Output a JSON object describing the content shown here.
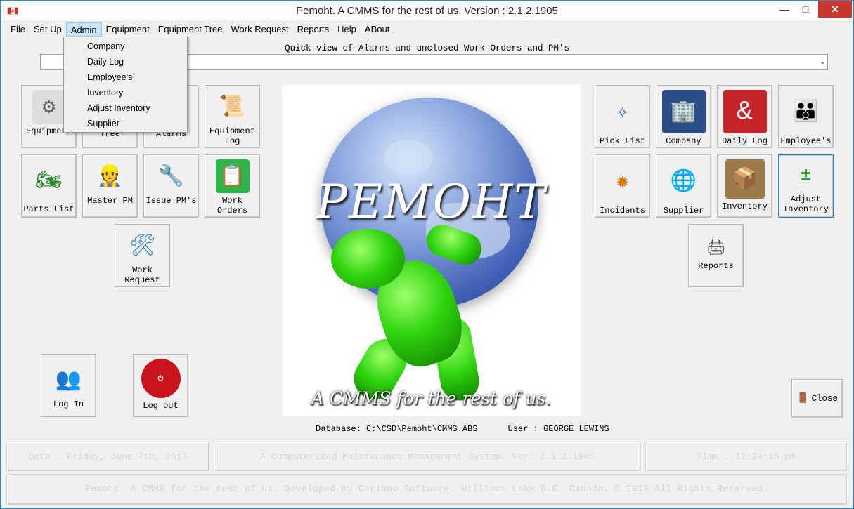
{
  "window": {
    "title": "Pemoht.  A CMMS for the rest of us.  Version : 2.1.2.1905"
  },
  "menu": [
    "File",
    "Set Up",
    "Admin",
    "Equipment",
    "Equipment Tree",
    "Work Request",
    "Reports",
    "Help",
    "ABout"
  ],
  "admin_menu": [
    "Company",
    "Daily Log",
    "Employee's",
    "Inventory",
    "Adjust Inventory",
    "Supplier"
  ],
  "quick_view_label": "Quick view of Alarms and unclosed Work Orders and PM's",
  "left_tiles": {
    "equipment": "Equipment",
    "tree": "Tree",
    "alarms": "Alarms",
    "equipment_log_1": "Equipment",
    "equipment_log_2": "Log",
    "parts_list": "Parts List",
    "master_pm": "Master PM",
    "issue_pms": "Issue PM's",
    "work_orders": "Work Orders",
    "work_request_1": "Work",
    "work_request_2": "Request"
  },
  "right_tiles": {
    "pick_list": "Pick List",
    "company": "Company",
    "daily_log": "Daily Log",
    "employees": "Employee's",
    "incidents": "Incidents",
    "supplier": "Supplier",
    "inventory": "Inventory",
    "adjust_inventory_1": "Adjust",
    "adjust_inventory_2": "Inventory",
    "reports": "Reports"
  },
  "login": "Log In",
  "logout": "Log out",
  "close": "Close",
  "splash": {
    "brand": "PEMOHT",
    "tagline": "A CMMS for the rest of us."
  },
  "database_line": "Database: C:\\CSD\\Pemoht\\CMMS.ABS      User : GEORGE LEWINS",
  "status": {
    "date": "Date : Friday, June 7th, 2013",
    "system": "A Computerized Maintenance Management System. Ver: 2.1.2.1905",
    "time": "Time : 12:24:15 pm"
  },
  "footer": "Pemoht.  A CMMS for the rest of us.  Developed by Cariboo Software.  Williams Lake B.C. Canada. © 2013 All Rights Reserved.",
  "colors": {
    "accent_border": "#1e8dcf",
    "close_red": "#c7372c",
    "menu_highlight": "#cce4f7"
  }
}
